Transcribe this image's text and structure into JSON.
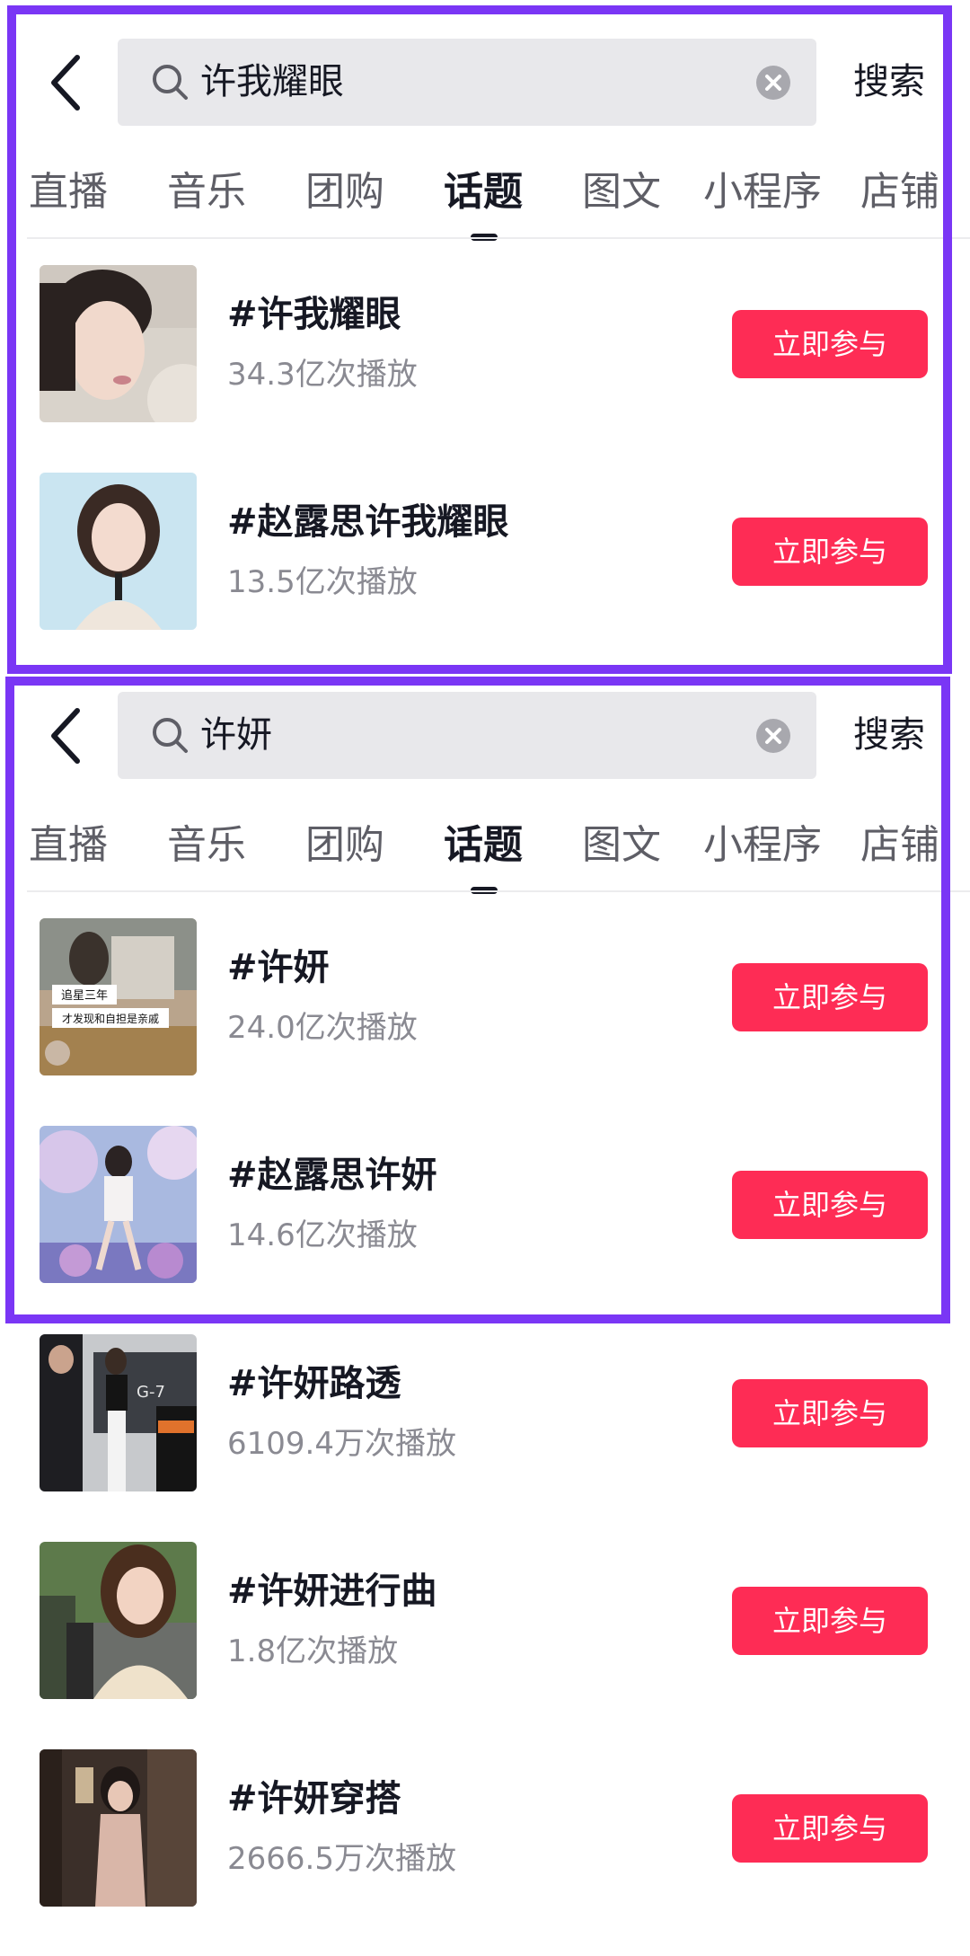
{
  "colors": {
    "frame": "#7a36f5",
    "accent": "#fe2c55",
    "search_bg": "#e8e8eb"
  },
  "icons": {
    "back": "chevron-left-icon",
    "search": "search-icon",
    "clear": "clear-icon"
  },
  "panels": [
    {
      "search": {
        "query": "许我耀眼",
        "action_label": "搜索"
      },
      "tabs": [
        "直播",
        "音乐",
        "团购",
        "话题",
        "图文",
        "小程序",
        "店铺"
      ],
      "active_tab": "话题",
      "results": [
        {
          "title": "#许我耀眼",
          "plays": "34.3亿次播放",
          "button": "立即参与"
        },
        {
          "title": "#赵露思许我耀眼",
          "plays": "13.5亿次播放",
          "button": "立即参与"
        }
      ]
    },
    {
      "search": {
        "query": "许妍",
        "action_label": "搜索"
      },
      "tabs": [
        "直播",
        "音乐",
        "团购",
        "话题",
        "图文",
        "小程序",
        "店铺"
      ],
      "active_tab": "话题",
      "results": [
        {
          "title": "#许妍",
          "plays": "24.0亿次播放",
          "button": "立即参与",
          "thumb_caption": [
            "追星三年",
            "才发现和自担是亲戚"
          ]
        },
        {
          "title": "#赵露思许妍",
          "plays": "14.6亿次播放",
          "button": "立即参与"
        },
        {
          "title": "#许妍路透",
          "plays": "6109.4万次播放",
          "button": "立即参与",
          "thumb_caption": [
            "G-7"
          ]
        },
        {
          "title": "#许妍进行曲",
          "plays": "1.8亿次播放",
          "button": "立即参与"
        },
        {
          "title": "#许妍穿搭",
          "plays": "2666.5万次播放",
          "button": "立即参与"
        }
      ]
    }
  ]
}
